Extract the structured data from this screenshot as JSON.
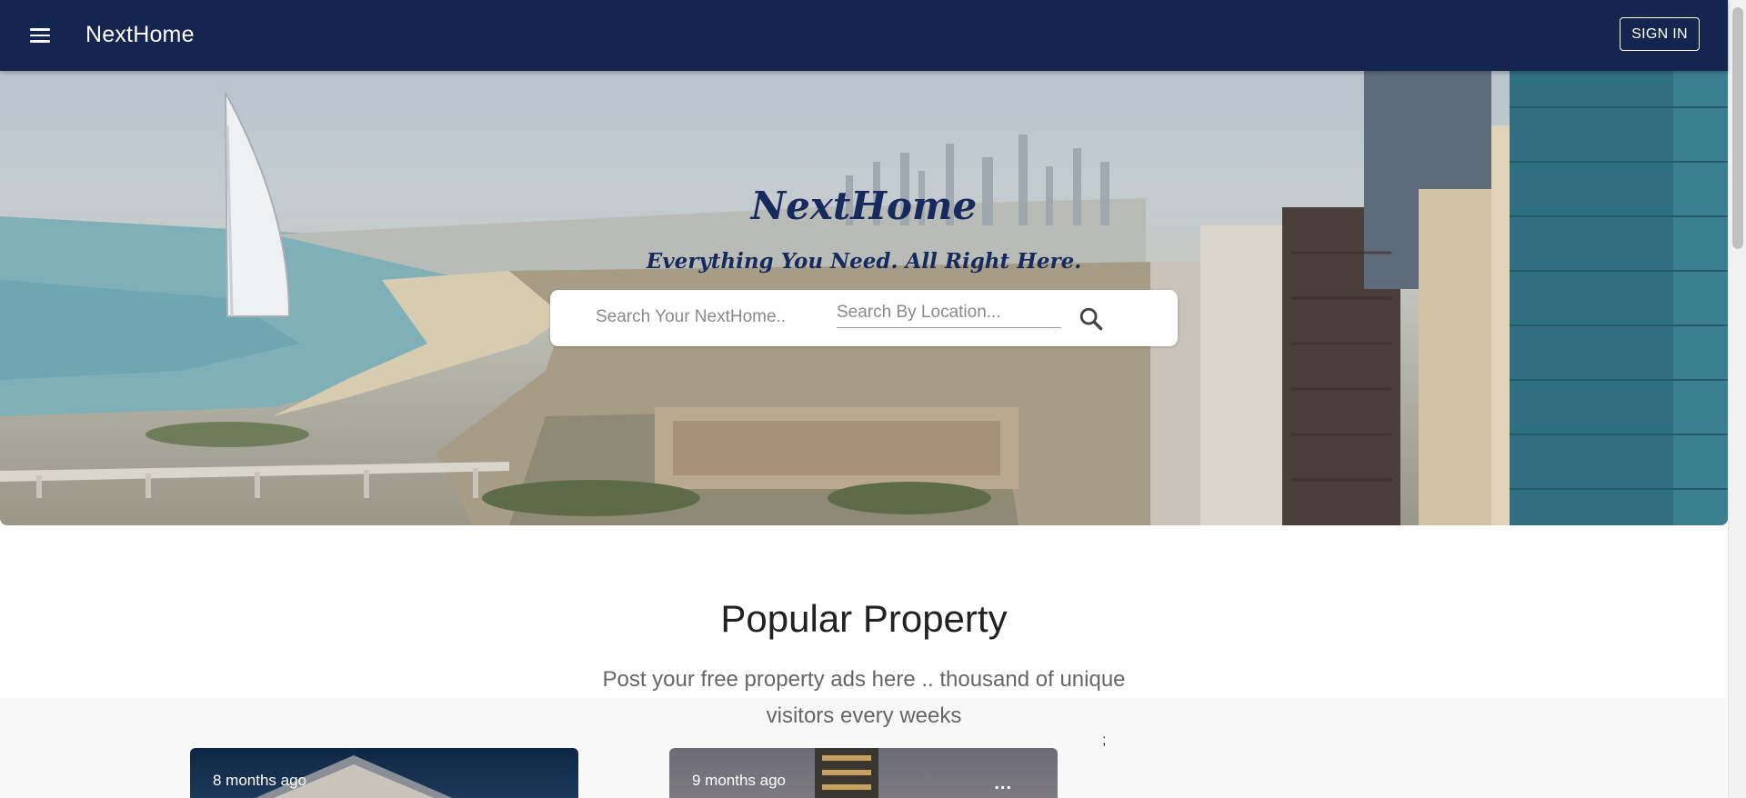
{
  "appbar": {
    "menu_icon": "menu-icon",
    "brand": "NextHome",
    "signin_label": "SIGN IN",
    "background": "#142650"
  },
  "hero": {
    "title": "NextHome",
    "tagline": "Everything You Need. All Right Here.",
    "search": {
      "main_placeholder": "Search Your NextHome..",
      "location_placeholder": "Search By Location...",
      "search_icon": "search-icon"
    }
  },
  "popular": {
    "title": "Popular Property",
    "subtitle": "Post your free property ads here .. thousand of unique visitors every weeks",
    "stray_text": ";",
    "cards": [
      {
        "time": "8 months ago"
      },
      {
        "time": "9 months ago",
        "menu": "..."
      }
    ]
  }
}
